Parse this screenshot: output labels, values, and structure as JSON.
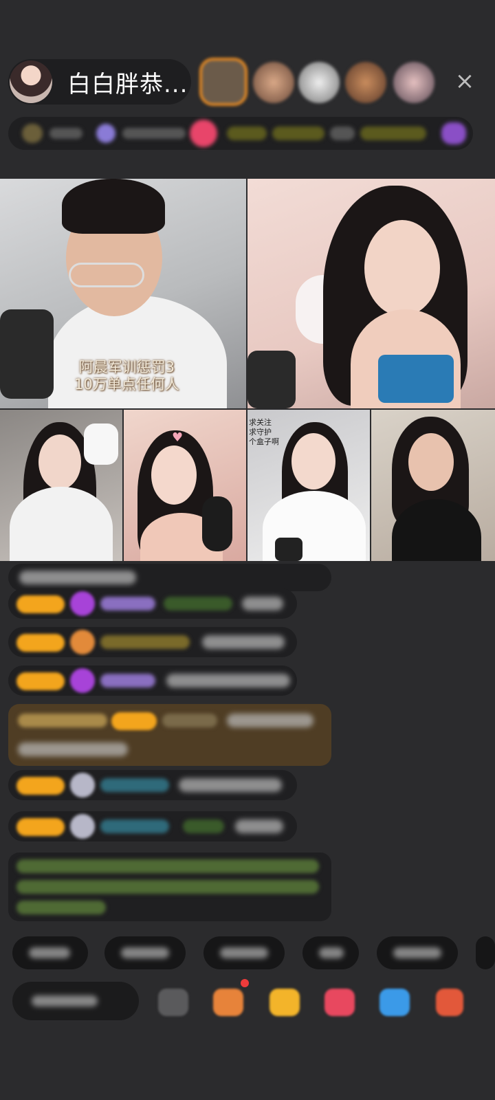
{
  "host": {
    "name": "白白胖恭..."
  },
  "close_label": "×",
  "video_grid": {
    "caption_line1": "阿晨军训惩罚3",
    "caption_line2": "10万单点任何人",
    "tag_line1": "求关注",
    "tag_line2": "求守护",
    "tag_line3": "个盒子啊"
  },
  "colors": {
    "background": "#2b2b2d",
    "accent_orange": "#f3a51d",
    "gold_row": "#4f3d24"
  }
}
